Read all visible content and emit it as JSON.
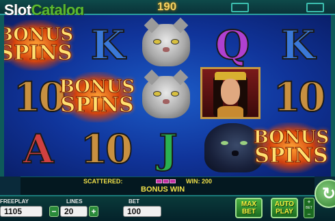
{
  "watermark": {
    "part1": "Slot",
    "part2": "Catalog"
  },
  "top_number": "190",
  "reels": {
    "r1c1": {
      "line1": "BONUS",
      "line2": "SPINS"
    },
    "r1c2": "K",
    "r1c3": "cat",
    "r1c4": "Q",
    "r1c5": "K",
    "r2c1": "10",
    "r2c2": {
      "line1": "BONUS",
      "line2": "SPINS"
    },
    "r2c3": "cat",
    "r2c4": "cleopatra",
    "r2c5": "10",
    "r3c1": "A",
    "r3c2": "10",
    "r3c3": "J",
    "r3c4": "panther",
    "r3c5": {
      "line1": "BONUS",
      "line2": "SPINS"
    }
  },
  "info": {
    "scattered_label": "SCATTERED:",
    "win_label": "WIN: 200",
    "bonus_win": "BONUS WIN"
  },
  "bottom": {
    "freeplay_label": "FREEPLAY",
    "freeplay_value": "1105",
    "lines_label": "LINES",
    "lines_value": "20",
    "lines_minus": "−",
    "lines_plus": "+",
    "bet_label": "BET",
    "bet_value": "100",
    "max_bet": "MAX BET",
    "auto_play": "AUTO PLAY",
    "bet_button": "BET",
    "bet_plus": "+",
    "bet_minus": "−"
  }
}
